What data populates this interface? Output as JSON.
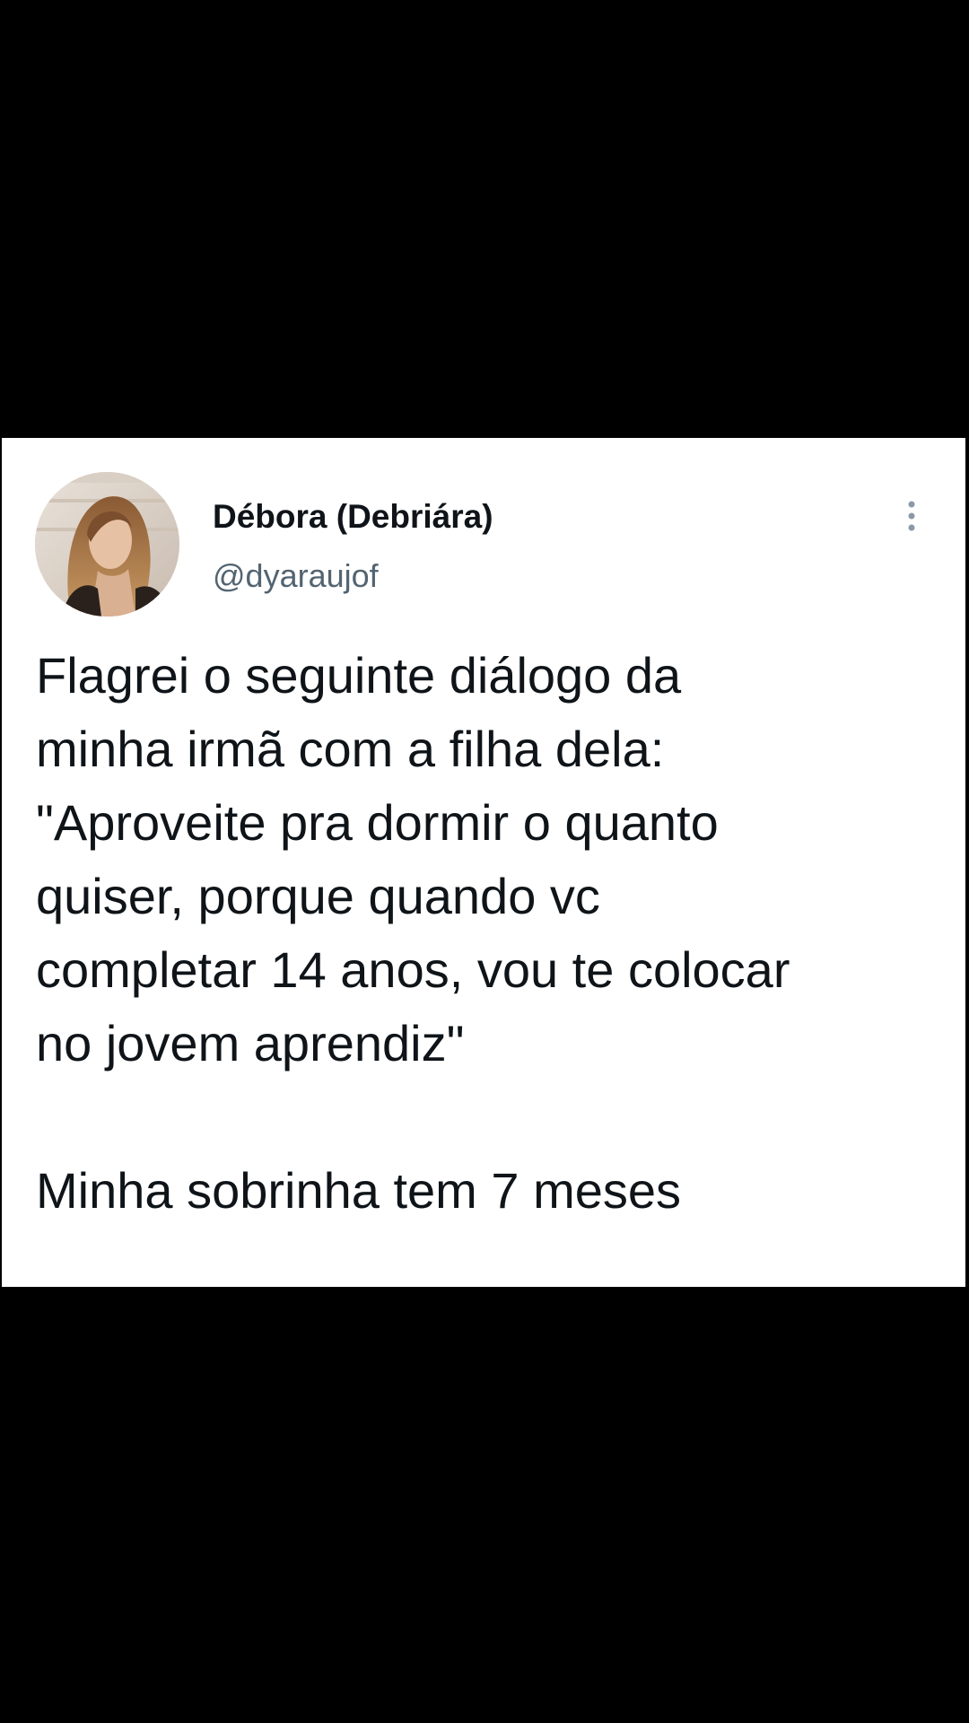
{
  "tweet": {
    "display_name": "Débora (Debriára)",
    "handle": "@dyaraujof",
    "text": "Flagrei o seguinte diálogo da\nminha irmã com a filha dela:\n\"Aproveite pra dormir o quanto\nquiser, porque quando vc\ncompletar 14 anos, vou te colocar\nno jovem aprendiz\"\n\nMinha sobrinha tem 7 meses"
  },
  "icons": {
    "avatar": "profile-photo",
    "more": "more-options-vertical-icon"
  },
  "colors": {
    "background": "#000000",
    "card": "#ffffff",
    "text_primary": "#0f1419",
    "text_secondary": "#536471"
  }
}
